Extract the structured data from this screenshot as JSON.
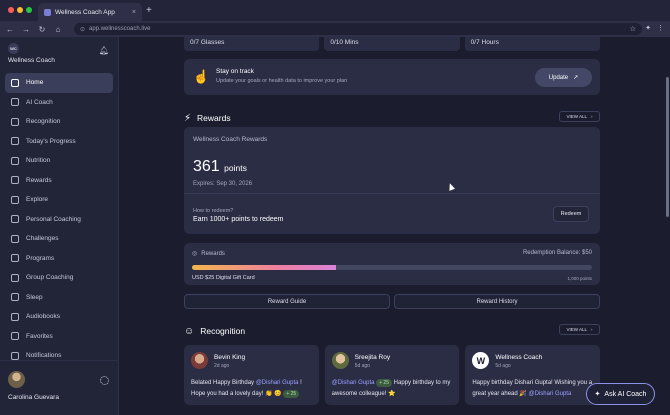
{
  "browser": {
    "tab_title": "Wellness Coach App",
    "url": "app.wellnesscoach.live",
    "traffic_colors": [
      "#ff5f57",
      "#febc2e",
      "#28c840"
    ]
  },
  "sidebar": {
    "logo_text": "WC",
    "brand": "Wellness Coach",
    "items": [
      {
        "label": "Home",
        "icon": "home-icon",
        "active": true
      },
      {
        "label": "AI Coach",
        "icon": "sparkle-icon"
      },
      {
        "label": "Recognition",
        "icon": "award-icon"
      },
      {
        "label": "Today's Progress",
        "icon": "chart-icon"
      },
      {
        "label": "Nutrition",
        "icon": "apple-icon"
      },
      {
        "label": "Rewards",
        "icon": "bolt-icon"
      },
      {
        "label": "Explore",
        "icon": "compass-icon"
      },
      {
        "label": "Personal Coaching",
        "icon": "person-icon"
      },
      {
        "label": "Challenges",
        "icon": "trophy-icon"
      },
      {
        "label": "Programs",
        "icon": "programs-icon"
      },
      {
        "label": "Group Coaching",
        "icon": "group-icon"
      },
      {
        "label": "Sleep",
        "icon": "moon-icon"
      },
      {
        "label": "Audiobooks",
        "icon": "book-icon"
      },
      {
        "label": "Favorites",
        "icon": "heart-icon"
      },
      {
        "label": "Notifications",
        "icon": "bell-icon"
      }
    ],
    "user_name": "Carolina Guevara"
  },
  "stats": [
    "0/7 Glasses",
    "0/10 Mins",
    "0/7 Hours"
  ],
  "banner": {
    "title": "Stay on track",
    "subtitle": "Update your goals or health data to improve your plan",
    "button": "Update"
  },
  "rewards": {
    "heading": "Rewards",
    "view_all": "VIEW ALL",
    "card_title": "Wellness Coach Rewards",
    "points": "361",
    "points_unit": "points",
    "expires": "Expires: Sep 30, 2026",
    "how_label": "How to redeem?",
    "earn_text": "Earn 1000+ points to redeem",
    "redeem_button": "Redeem"
  },
  "progress": {
    "label": "Rewards",
    "balance": "Redemption Balance: $50",
    "fill_percent": 36,
    "left_label": "USD $25 Digital Gift Card",
    "right_label": "1,000 points"
  },
  "buttons": {
    "guide": "Reward Guide",
    "history": "Reward History"
  },
  "recognition": {
    "heading": "Recognition",
    "view_all": "VIEW ALL",
    "posts": [
      {
        "name": "Bevin King",
        "time": "2d ago",
        "body_pre": "Belated Happy Birthday ",
        "mention": "@Dishari Gupta",
        "body_post": " ! Hope you had a lovely day! 👏 😊",
        "pill": "+ 25"
      },
      {
        "name": "Sreejita Roy",
        "time": "5d ago",
        "mention": "@Dishari Gupta",
        "pill": "+ 25",
        "body_post": " Happy birthday to my awesome colleague! ⭐"
      },
      {
        "name": "Wellness Coach",
        "time": "5d ago",
        "body_pre": "Happy birthday Dishari Gupta! Wishing you a great year ahead 🎉 ",
        "mention": "@Dishari Gupta"
      }
    ]
  },
  "ask_button": "Ask AI Coach"
}
